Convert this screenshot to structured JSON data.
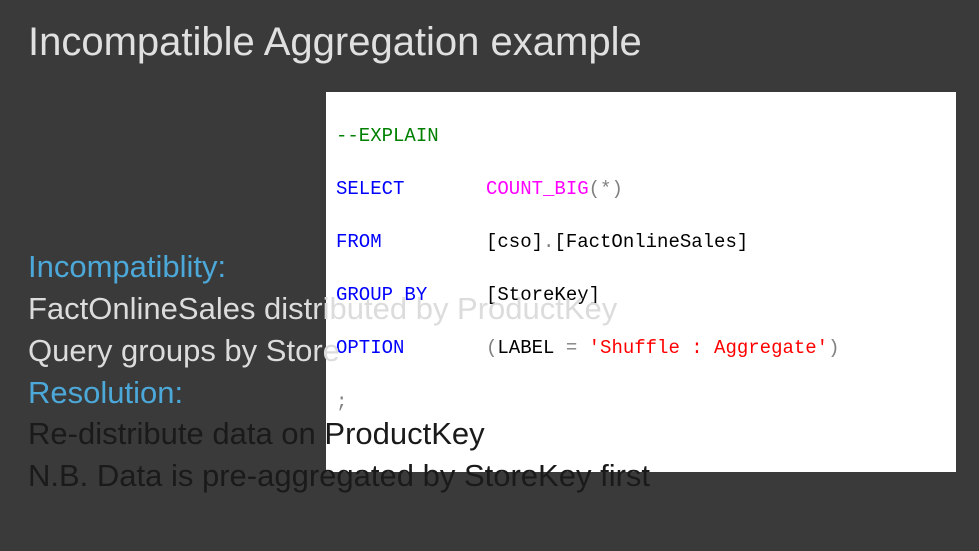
{
  "slide": {
    "title": "Incompatible Aggregation example",
    "code": {
      "line1_comment": "--EXPLAIN",
      "line2_kw": "SELECT",
      "line2_func": "COUNT_BIG",
      "line2_paren_open": "(",
      "line2_star": "*",
      "line2_paren_close": ")",
      "line3_kw": "FROM",
      "line3_schema_open": "[cso]",
      "line3_dot": ".",
      "line3_table": "[FactOnlineSales]",
      "line4_kw": "GROUP BY",
      "line4_col": "[StoreKey]",
      "line5_kw": "OPTION",
      "line5_paren_open": "(",
      "line5_label_kw": "LABEL",
      "line5_eq": " = ",
      "line5_string": "'Shuffle : Aggregate'",
      "line5_paren_close": ")",
      "line6_semi": ";"
    },
    "body": {
      "incompat_label": "Incompatiblity:",
      "incompat_line1": "FactOnlineSales distributed by ProductKey",
      "incompat_line2": "Query groups by Store",
      "resolution_label": "Resolution:",
      "resolution_line1": "Re-distribute data on ProductKey",
      "resolution_line2": "N.B. Data is pre-aggregated by StoreKey first"
    }
  }
}
